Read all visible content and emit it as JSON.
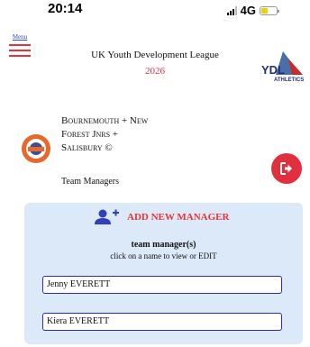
{
  "status": {
    "time": "20:14",
    "network": "4G",
    "battery_color": "#f2d000",
    "battery_level": 0.45
  },
  "header": {
    "menu_label": "Menu",
    "title": "UK Youth Development League",
    "year": "2026",
    "logo_text": "YDL",
    "logo_subtext": "ATHLETICS"
  },
  "club": {
    "name": "Bournemouth + New Forest Jnrs + Salisbury ©",
    "subtitle": "Team Managers",
    "badge_text": "BOURNEMOUTH"
  },
  "actions": {
    "logout_icon": "logout-icon"
  },
  "managers": {
    "add_label": "ADD NEW MANAGER",
    "title": "team manager(s)",
    "subtitle": "click on a name to view or EDIT",
    "list": [
      "Jenny EVERETT",
      "Kiera EVERETT"
    ]
  },
  "colors": {
    "accent_red": "#e8323a",
    "logout_red": "#e0303e",
    "panel_bg": "#dbe9f8",
    "field_border": "#2b2fae",
    "add_icon_blue": "#2f3fbd"
  }
}
